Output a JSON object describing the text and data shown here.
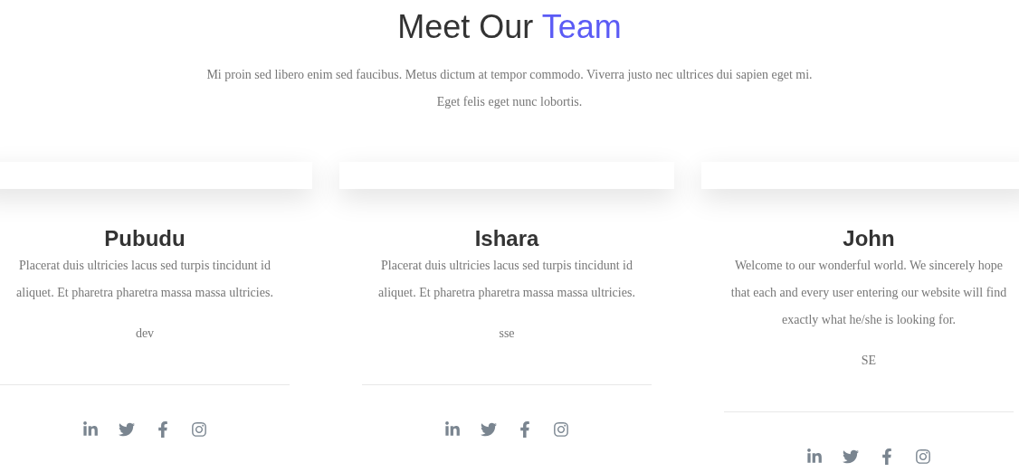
{
  "heading": {
    "text": "Meet Our",
    "highlight": "Team"
  },
  "intro": "Mi proin sed libero enim sed faucibus. Metus dictum at tempor commodo. Viverra justo nec ultrices dui sapien eget mi. Eget felis eget nunc lobortis.",
  "members": [
    {
      "name": "Pubudu",
      "bio": "Placerat duis ultricies lacus sed turpis tincidunt id aliquet. Et pharetra pharetra massa massa ultricies.",
      "role": "dev",
      "social": [
        {
          "kind": "linkedin"
        },
        {
          "kind": "twitter"
        },
        {
          "kind": "facebook"
        },
        {
          "kind": "instagram"
        }
      ]
    },
    {
      "name": "Ishara",
      "bio": "Placerat duis ultricies lacus sed turpis tincidunt id aliquet. Et pharetra pharetra massa massa ultricies.",
      "role": "sse",
      "social": [
        {
          "kind": "linkedin"
        },
        {
          "kind": "twitter"
        },
        {
          "kind": "facebook"
        },
        {
          "kind": "instagram"
        }
      ]
    },
    {
      "name": "John",
      "bio": "Welcome to our wonderful world. We sincerely hope that each and every user entering our website will find exactly what he/she is looking for.",
      "role": "SE",
      "social": [
        {
          "kind": "linkedin"
        },
        {
          "kind": "twitter"
        },
        {
          "kind": "facebook"
        },
        {
          "kind": "instagram"
        }
      ]
    }
  ]
}
